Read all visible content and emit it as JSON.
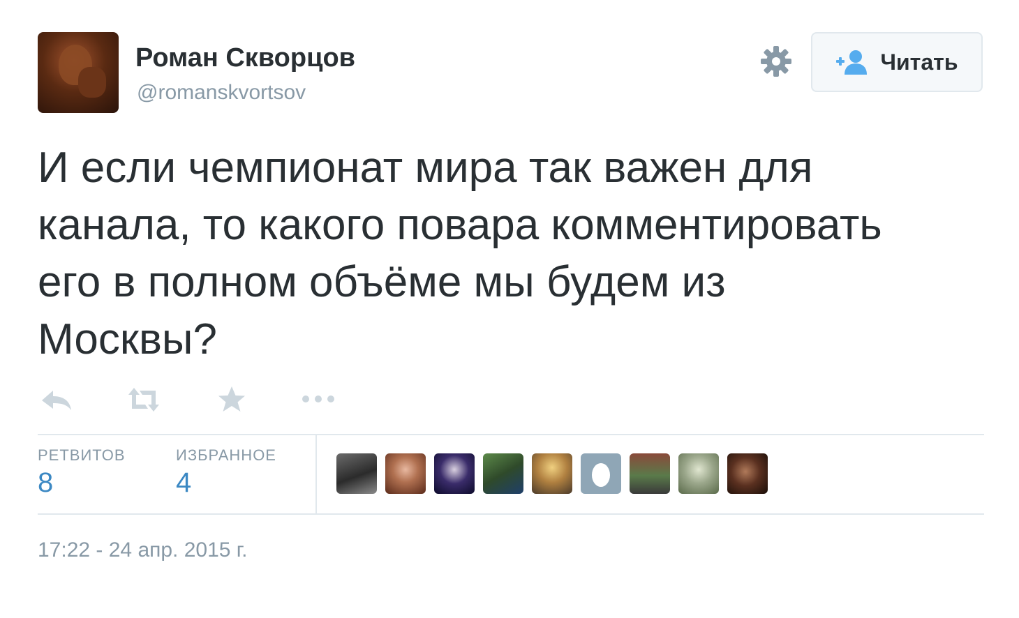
{
  "author": {
    "fullname": "Роман Скворцов",
    "username": "@romanskvortsov"
  },
  "follow_button": {
    "label": "Читать"
  },
  "tweet": {
    "text_lines": [
      "И если чемпионат мира так важен для",
      "канала, то какого повара комментировать",
      "его в полном объёме мы будем из",
      "Москвы?"
    ]
  },
  "stats": {
    "retweets_label": "РЕТВИТОВ",
    "retweets_count": "8",
    "favorites_label": "ИЗБРАННОЕ",
    "favorites_count": "4"
  },
  "timestamp": "17:22 - 24 апр. 2015 г.",
  "icons": {
    "settings": "gear-icon",
    "follow": "add-user-icon",
    "reply": "reply-icon",
    "retweet": "retweet-icon",
    "favorite": "star-icon",
    "more": "more-icon"
  },
  "colors": {
    "text": "#292f33",
    "muted": "#8899a6",
    "link": "#3b88c3",
    "follow_icon": "#55acee",
    "border": "#e1e8ed"
  }
}
